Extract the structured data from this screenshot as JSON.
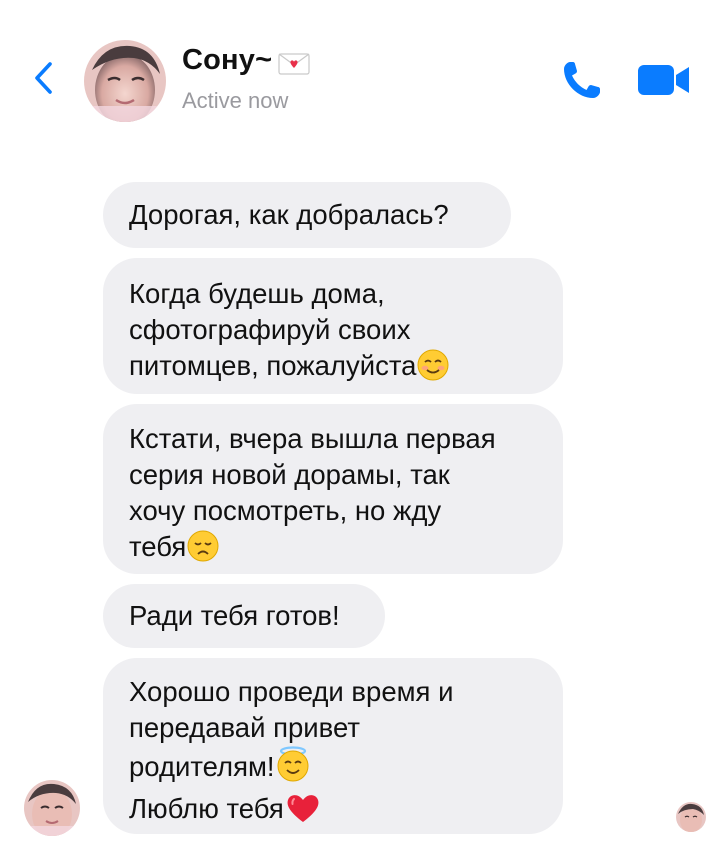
{
  "header": {
    "contact_name": "Сону~",
    "status": "Active now"
  },
  "icons": {
    "back": "chevron-left-icon",
    "call": "phone-icon",
    "video": "video-camera-icon",
    "envelope": "love-letter-icon"
  },
  "colors": {
    "accent": "#0a7cff",
    "bubble": "#efeff2",
    "status_text": "#9a9a9f"
  },
  "messages": [
    {
      "lines": [
        "Дорогая, как добралась?"
      ]
    },
    {
      "lines": [
        "Когда будешь дома,",
        "сфотографируй своих",
        "питомцев, пожалуйста"
      ],
      "emoji": "smiling-face"
    },
    {
      "lines": [
        "Кстати, вчера вышла первая",
        "серия новой дорамы, так",
        "хочу посмотреть, но жду",
        "тебя"
      ],
      "emoji": "disappointed-face"
    },
    {
      "lines": [
        "Ради тебя готов!"
      ]
    },
    {
      "lines": [
        "Хорошо проведи время и",
        "передавай привет",
        "родителям!",
        "Люблю тебя"
      ],
      "emojis": [
        "halo-face",
        "red-heart"
      ]
    }
  ]
}
